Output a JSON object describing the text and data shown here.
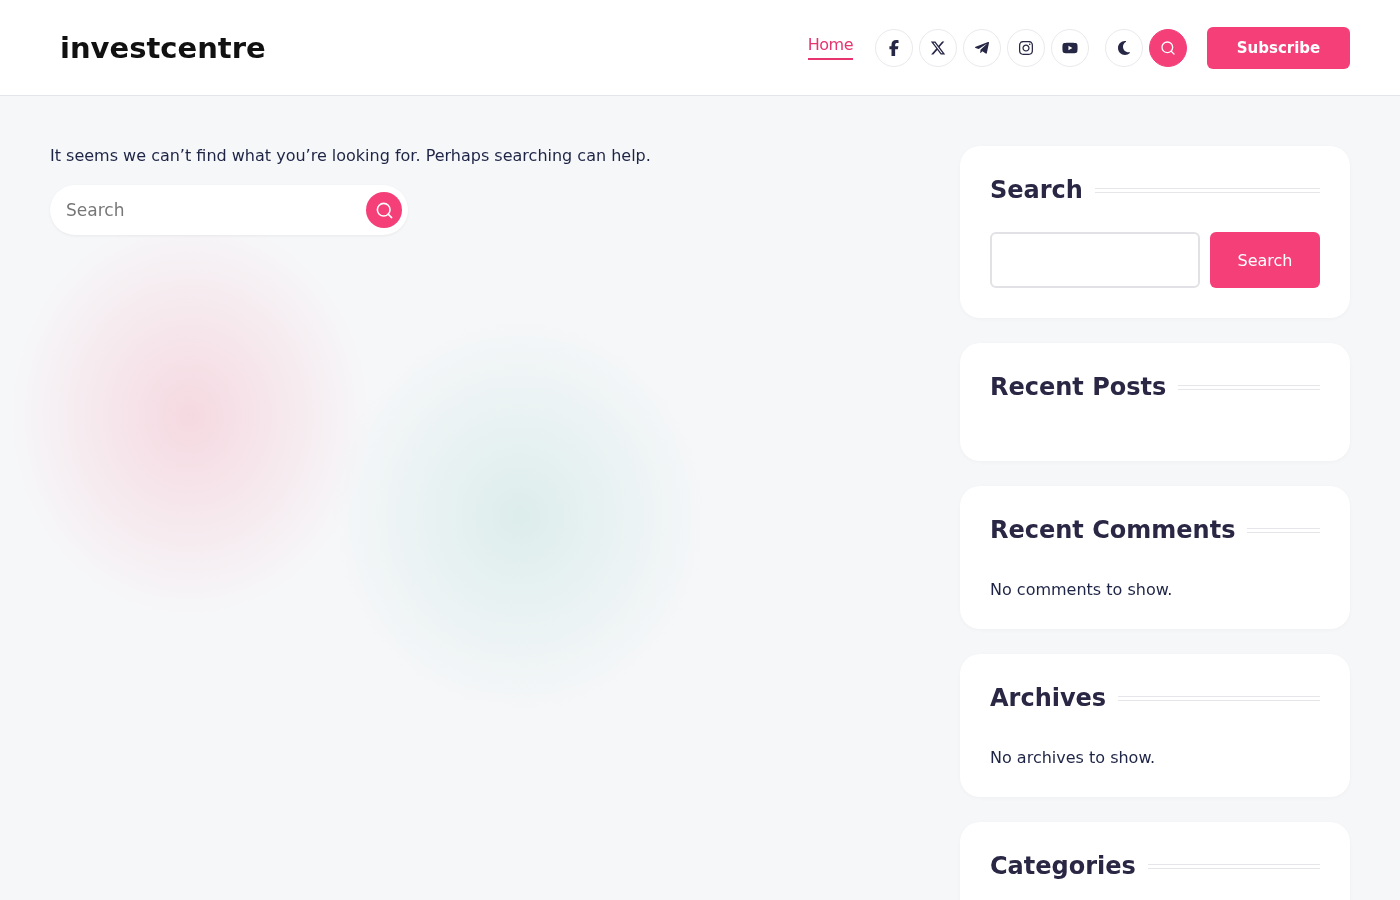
{
  "header": {
    "logo": "investcentre",
    "nav": [
      {
        "label": "Home",
        "selected": true
      }
    ],
    "subscribe": "Subscribe"
  },
  "content": {
    "message": "It seems we can’t find what you’re looking for. Perhaps searching can help.",
    "search": {
      "placeholder": "Search"
    }
  },
  "sidebar": [
    {
      "kind": "search",
      "title": "Search",
      "button": "Search"
    },
    {
      "kind": "list",
      "title": "Recent Posts"
    },
    {
      "kind": "list",
      "title": "Recent Comments",
      "empty": "No comments to show."
    },
    {
      "kind": "list",
      "title": "Archives",
      "empty": "No archives to show."
    },
    {
      "kind": "list",
      "title": "Categories"
    }
  ]
}
